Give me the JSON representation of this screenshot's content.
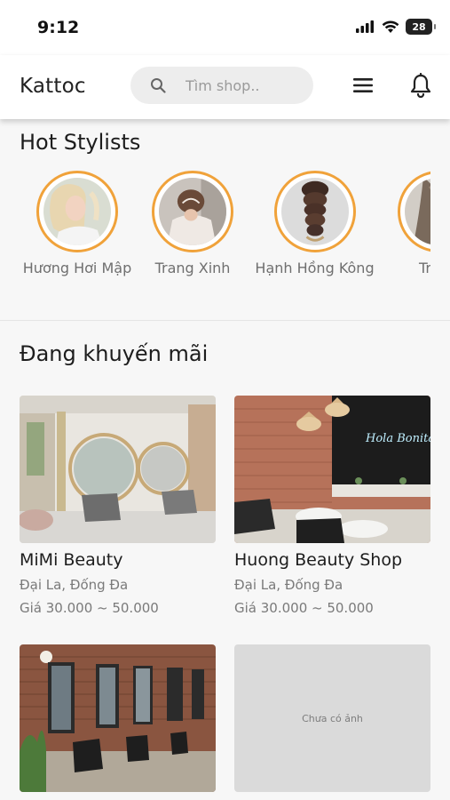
{
  "status_bar": {
    "time": "9:12",
    "battery": "28"
  },
  "header": {
    "logo": "Kattoc",
    "search_placeholder": "Tìm shop..",
    "icons": [
      "search-icon",
      "menu-icon",
      "bell-icon"
    ]
  },
  "hot_stylists": {
    "title": "Hot Stylists",
    "items": [
      {
        "name": "Hương Hơi Mập"
      },
      {
        "name": "Trang Xinh"
      },
      {
        "name": "Hạnh Hồng Kông"
      },
      {
        "name": "Trang"
      }
    ]
  },
  "promotions": {
    "title": "Đang khuyến mãi",
    "shops": [
      {
        "name": "MiMi Beauty",
        "address": "Đại La, Đống Đa",
        "price": "Giá 30.000 ~ 50.000"
      },
      {
        "name": "Huong Beauty Shop",
        "address": "Đại La, Đống Đa",
        "price": "Giá 30.000 ~ 50.000",
        "neon_sign": "Hola Bonita"
      },
      {
        "name": "",
        "address": "",
        "price": ""
      },
      {
        "name": "",
        "address": "",
        "price": "",
        "no_image_text": "Chưa có ảnh"
      }
    ]
  },
  "colors": {
    "accent_ring": "#f0a23a",
    "background": "#f7f7f7",
    "header_bg": "#ffffff"
  }
}
